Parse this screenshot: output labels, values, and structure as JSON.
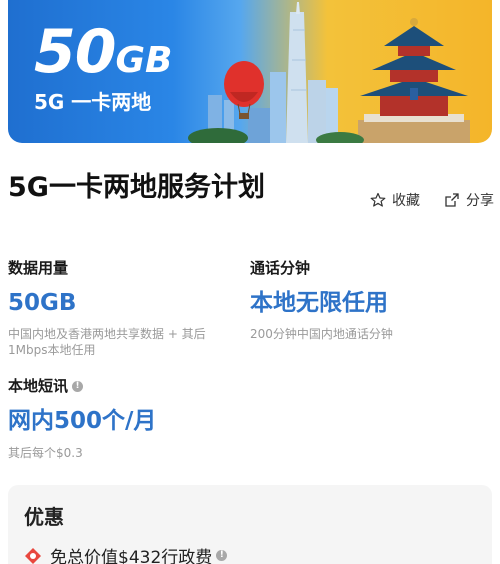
{
  "banner": {
    "big_number": "50",
    "big_unit": "GB",
    "subtitle": "5G 一卡两地"
  },
  "page_title": "5G一卡两地服务计划",
  "actions": {
    "favorite_label": "收藏",
    "share_label": "分享"
  },
  "plan": {
    "data": {
      "label": "数据用量",
      "value": "50GB",
      "note_line1": "中国内地及香港两地共享数据 + 其后",
      "note_line2": "1Mbps本地任用"
    },
    "calls": {
      "label": "通话分钟",
      "value": "本地无限任用",
      "note": "200分钟中国内地通话分钟"
    },
    "sms": {
      "label": "本地短讯",
      "value": "网内500个/月",
      "note": "其后每个$0.3"
    }
  },
  "offers": {
    "title": "优惠",
    "items": [
      {
        "text": "免总价值$432行政费"
      }
    ]
  },
  "colors": {
    "accent": "#2e73c8",
    "banner_blue": "#1f6fd0",
    "banner_gold": "#f4b52a",
    "card_bg": "#f5f5f5"
  }
}
